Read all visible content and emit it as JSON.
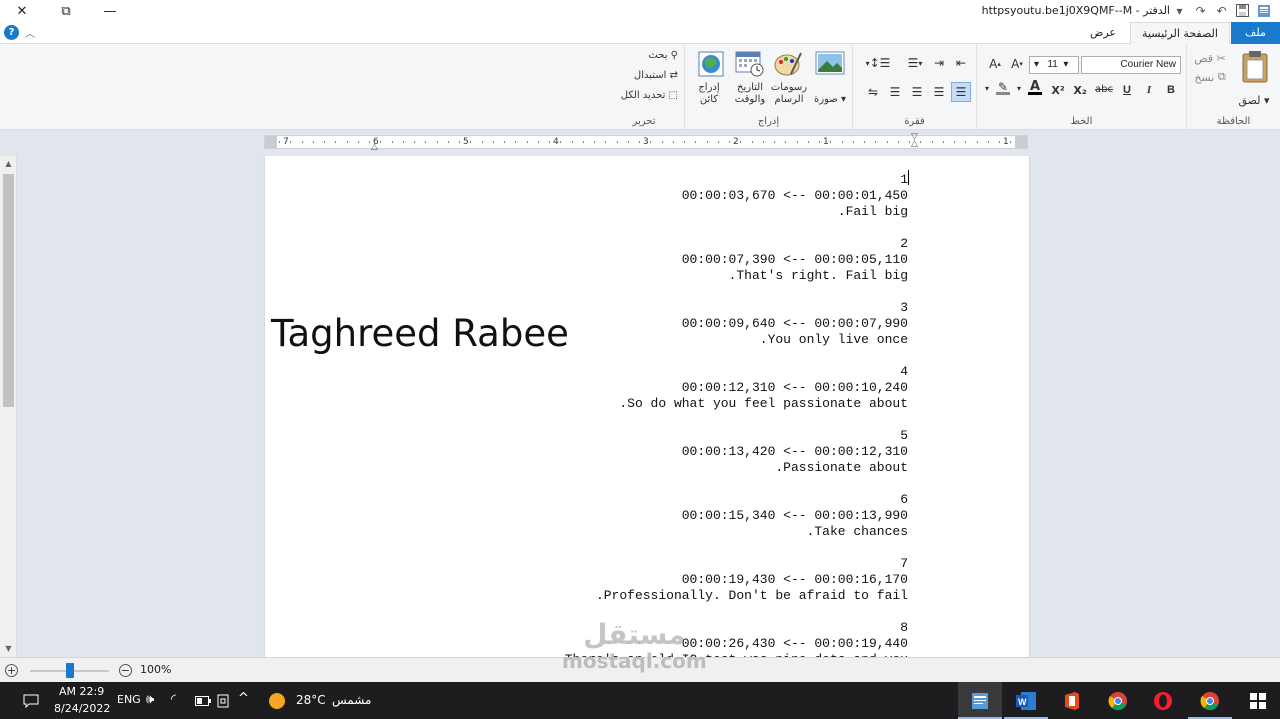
{
  "window": {
    "title": "httpsyoutu.be1j0X9QMF--M - الدفتر",
    "controls": [
      "close-icon",
      "restore-icon",
      "minimize-icon"
    ]
  },
  "tabs": [
    {
      "label": "ملف",
      "active": false
    },
    {
      "label": "الصفحة الرئيسية",
      "active": true
    },
    {
      "label": "عرض",
      "active": false
    }
  ],
  "ribbon": {
    "clipboard": {
      "label": "الحافظة",
      "paste": "لصق",
      "cut": "قص",
      "copy": "نسخ"
    },
    "font": {
      "label": "الخط",
      "family": "Courier New",
      "size": "11",
      "bold": "B",
      "italic": "I",
      "underline": "U",
      "strike": "abc",
      "subscript": "X₂",
      "superscript": "X²"
    },
    "paragraph": {
      "label": "فقرة"
    },
    "insert": {
      "label": "إدراج",
      "picture": "صورة",
      "paint": "رسومات الرسام",
      "datetime": "التاريخ والوقت",
      "object": "إدراج كائن"
    },
    "editing": {
      "label": "تحرير",
      "find": "بحث",
      "replace": "استبدال",
      "selectall": "تحديد الكل"
    }
  },
  "ruler": {
    "labels": [
      "7",
      "6",
      "5",
      "4",
      "3",
      "2",
      "1",
      "1"
    ]
  },
  "document": {
    "overlay_name": "Taghreed Rabee",
    "lines": [
      "1",
      "00:00:03,670 <-- 00:00:01,450",
      ".Fail big",
      "",
      "2",
      "00:00:07,390 <-- 00:00:05,110",
      ".That's right. Fail big",
      "",
      "3",
      "00:00:09,640 <-- 00:00:07,990",
      ".You only live once",
      "",
      "4",
      "00:00:12,310 <-- 00:00:10,240",
      ".So do what you feel passionate about",
      "",
      "5",
      "00:00:13,420 <-- 00:00:12,310",
      ".Passionate about",
      "",
      "6",
      "00:00:15,340 <-- 00:00:13,990",
      ".Take chances",
      "",
      "7",
      "00:00:19,430 <-- 00:00:16,170",
      ".Professionally. Don't be afraid to fail",
      "",
      "8",
      "00:00:26,430 <-- 00:00:19,440",
      "There's an old IQ test was nine dots and you"
    ]
  },
  "statusbar": {
    "zoom": "100%",
    "zoom_level": 0.5
  },
  "taskbar": {
    "time": "AM 22:9",
    "date": "8/24/2022",
    "lang": "ENG",
    "temperature": "28°C",
    "weather": "مشمس",
    "watermark_ar": "مستقل",
    "watermark_en": "mostaql.com",
    "apps": [
      "wordpad-icon",
      "word-icon",
      "office-icon",
      "chrome-icon",
      "opera-icon",
      "chrome-profile-icon",
      "windows-start-icon"
    ]
  }
}
